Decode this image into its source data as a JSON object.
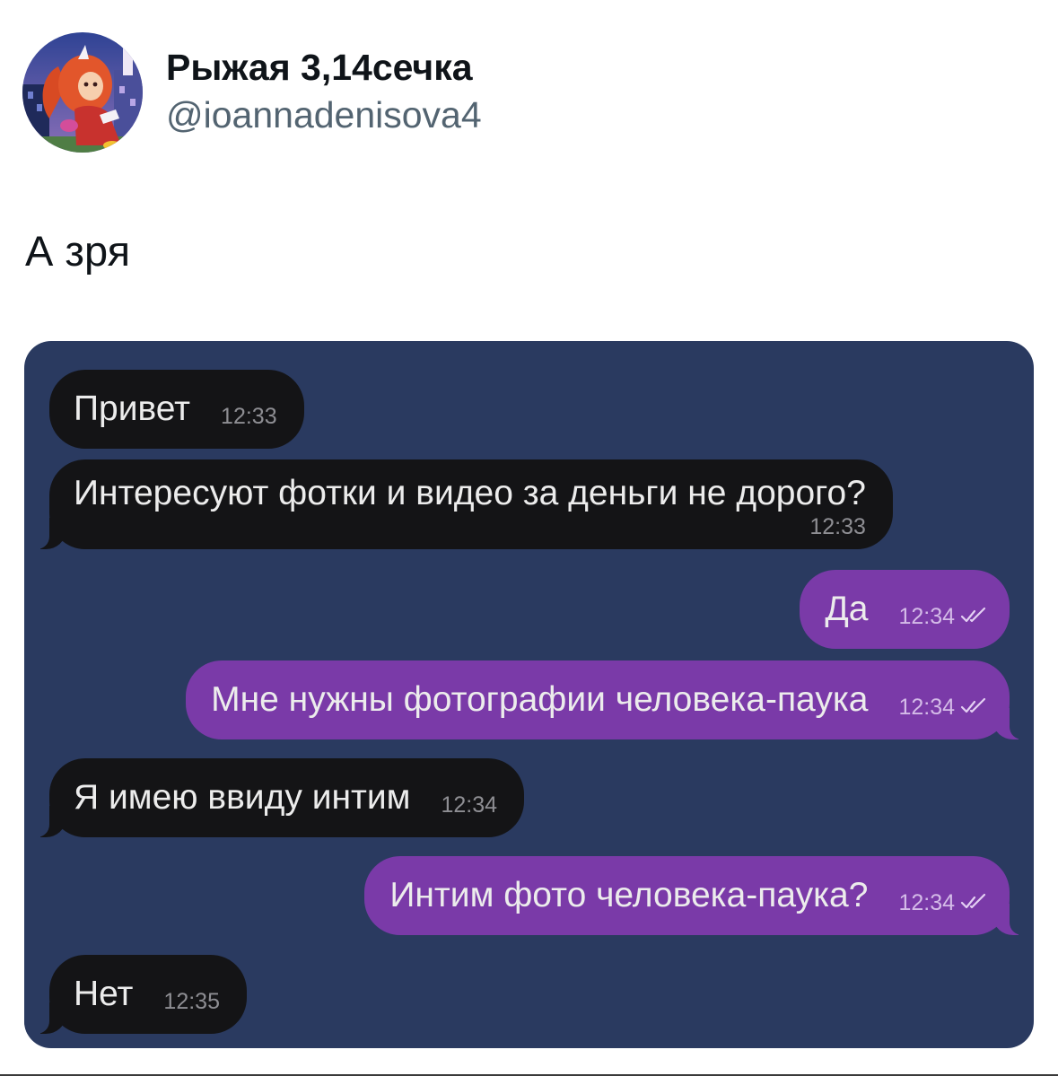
{
  "tweet": {
    "author": {
      "name": "Рыжая 3,14сечка",
      "handle": "@ioannadenisova4",
      "avatar_icon": "avatar-image"
    },
    "text": "А зря"
  },
  "chat": {
    "colors": {
      "background": "#2a3a60",
      "incoming_bubble": "#141416",
      "outgoing_bubble": "#7a3aa8",
      "incoming_time": "#8e8e93",
      "outgoing_time": "#d4bbe8"
    },
    "messages": [
      {
        "text": "Привет",
        "time": "12:33"
      },
      {
        "text": "Интересуют фотки и видео за деньги не дорого?",
        "time": "12:33"
      },
      {
        "text": "Да",
        "time": "12:34",
        "status_icon": "double-check-icon"
      },
      {
        "text": "Мне нужны фотографии человека-паука",
        "time": "12:34",
        "status_icon": "double-check-icon"
      },
      {
        "text": "Я имею ввиду интим",
        "time": "12:34"
      },
      {
        "text": "Интим фото человека-паука?",
        "time": "12:34",
        "status_icon": "double-check-icon"
      },
      {
        "text": "Нет",
        "time": "12:35"
      }
    ]
  }
}
